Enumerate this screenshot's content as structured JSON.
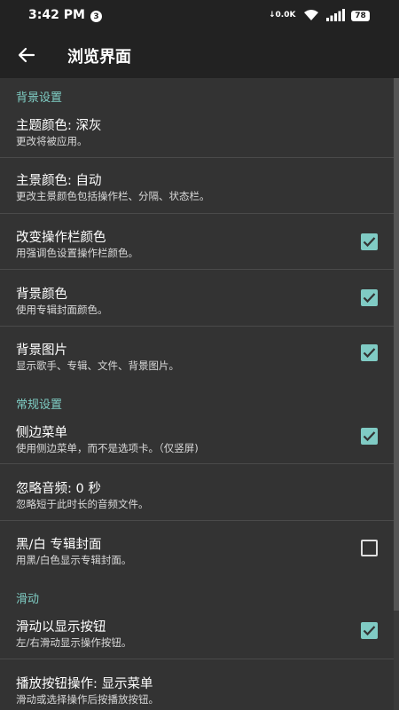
{
  "status_bar": {
    "time": "3:42 PM",
    "notification_count": "3",
    "network_speed": "0.0K",
    "battery": "78"
  },
  "app_bar": {
    "title": "浏览界面"
  },
  "sections": {
    "background": "背景设置",
    "general": "常规设置",
    "swipe": "滑动"
  },
  "prefs": {
    "theme_color": {
      "title": "主题颜色: 深灰",
      "summary": "更改将被应用。"
    },
    "primary_color": {
      "title": "主景颜色: 自动",
      "summary": "更改主景颜色包括操作栏、分隔、状态栏。"
    },
    "actionbar_color": {
      "title": "改变操作栏颜色",
      "summary": "用强调色设置操作栏颜色。",
      "checked": true
    },
    "bg_color": {
      "title": "背景颜色",
      "summary": "使用专辑封面颜色。",
      "checked": true
    },
    "bg_image": {
      "title": "背景图片",
      "summary": "显示歌手、专辑、文件、背景图片。",
      "checked": true
    },
    "side_menu": {
      "title": "侧边菜单",
      "summary": "使用侧边菜单，而不是选项卡。（仅竖屏)",
      "checked": true
    },
    "ignore_audio": {
      "title": "忽略音频: 0 秒",
      "summary": "忽略短于此时长的音频文件。"
    },
    "bw_cover": {
      "title": "黑/白 专辑封面",
      "summary": "用黑/白色显示专辑封面。",
      "checked": false
    },
    "swipe_buttons": {
      "title": "滑动以显示按钮",
      "summary": "左/右滑动显示操作按钮。",
      "checked": true
    },
    "play_button_action": {
      "title": "播放按钮操作: 显示菜单",
      "summary": "滑动或选择操作后按播放按钮。"
    }
  },
  "colors": {
    "accent": "#80cbc4",
    "background": "#333333",
    "bar": "#222222"
  }
}
